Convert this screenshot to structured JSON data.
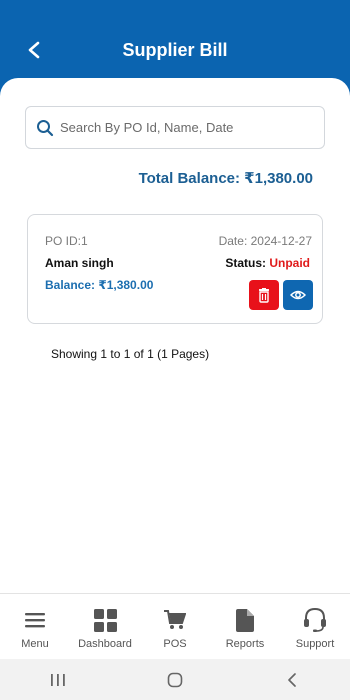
{
  "header": {
    "title": "Supplier Bill"
  },
  "search": {
    "placeholder": "Search By PO Id, Name, Date"
  },
  "summary": {
    "total_balance": "Total Balance: ₹1,380.00"
  },
  "bills": [
    {
      "po_id": "PO ID:1",
      "date": "Date: 2024-12-27",
      "name": "Aman singh",
      "status_label": "Status:",
      "status_value": "Unpaid",
      "balance": "Balance: ₹1,380.00"
    }
  ],
  "pagination": {
    "text": "Showing 1 to 1 of 1 (1 Pages)"
  },
  "bottom_nav": {
    "items": [
      {
        "label": "Menu",
        "icon": "menu-icon"
      },
      {
        "label": "Dashboard",
        "icon": "dashboard-icon"
      },
      {
        "label": "POS",
        "icon": "cart-icon"
      },
      {
        "label": "Reports",
        "icon": "document-icon"
      },
      {
        "label": "Support",
        "icon": "headset-icon"
      }
    ]
  },
  "colors": {
    "header": "#0b64b0",
    "accent": "#1c5f93",
    "danger": "#e8111a",
    "status_unpaid": "#e01a1a"
  }
}
